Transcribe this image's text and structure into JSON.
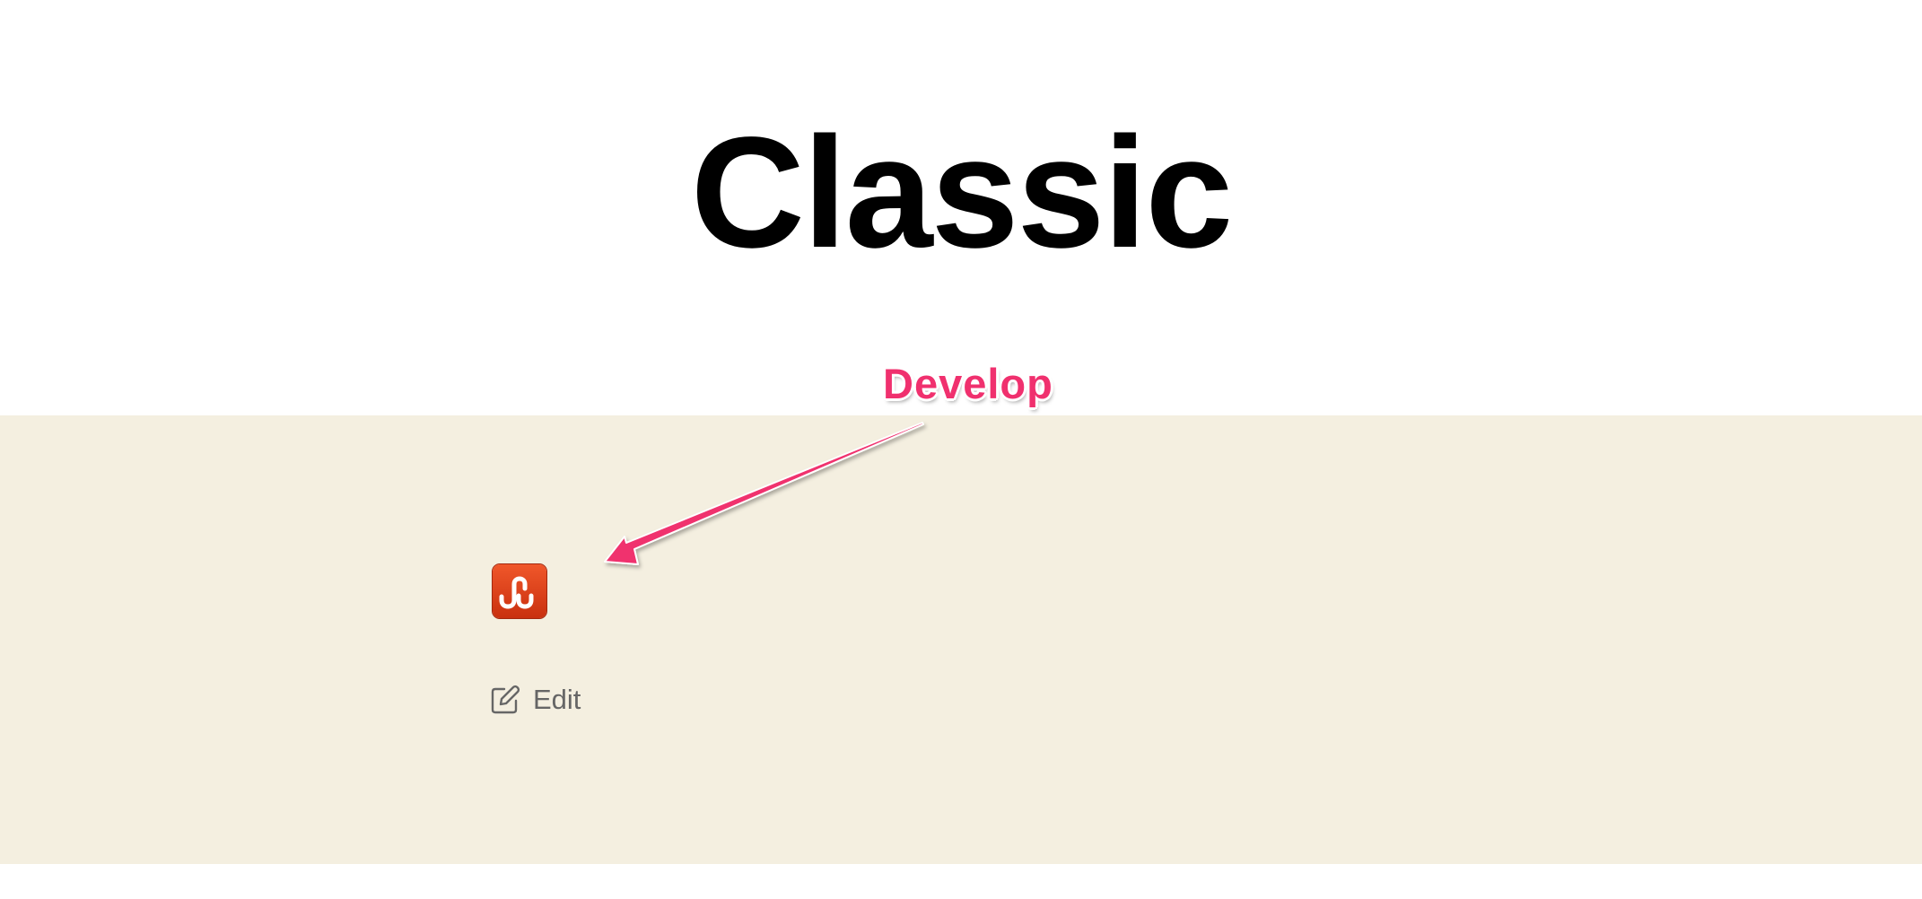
{
  "page": {
    "title": "Classic",
    "background": "#ffffff",
    "band_color": "#f4efe0"
  },
  "app_icon": {
    "icon": "stumbleupon-icon",
    "color": "#e0431e"
  },
  "edit_link": {
    "icon": "edit-icon",
    "label": "Edit"
  },
  "annotation": {
    "label": "Develop",
    "color": "#f0306e"
  }
}
